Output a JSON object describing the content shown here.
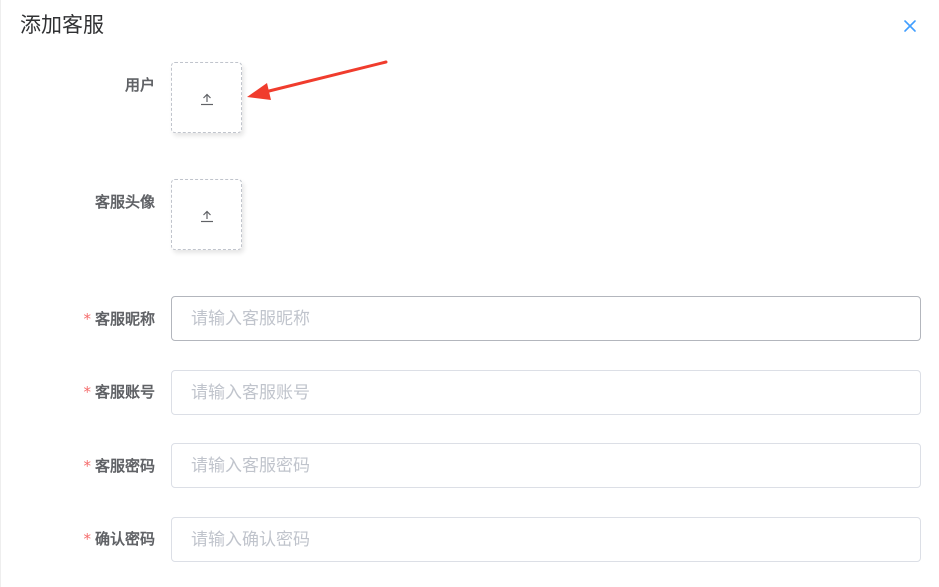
{
  "dialog": {
    "title": "添加客服",
    "close_icon": "close-icon"
  },
  "form": {
    "user": {
      "label": "用户",
      "icon": "upload-icon"
    },
    "avatar": {
      "label": "客服头像",
      "icon": "upload-icon"
    },
    "nickname": {
      "required_mark": "*",
      "label": "客服昵称",
      "value": "",
      "placeholder": "请输入客服昵称"
    },
    "account": {
      "required_mark": "*",
      "label": "客服账号",
      "value": "",
      "placeholder": "请输入客服账号"
    },
    "password": {
      "required_mark": "*",
      "label": "客服密码",
      "value": "",
      "placeholder": "请输入客服密码"
    },
    "confirm_password": {
      "required_mark": "*",
      "label": "确认密码",
      "value": "",
      "placeholder": "请输入确认密码"
    }
  },
  "colors": {
    "required": "#f56c6c",
    "close_icon": "#409eff",
    "annotation_arrow": "#f03c2d"
  }
}
